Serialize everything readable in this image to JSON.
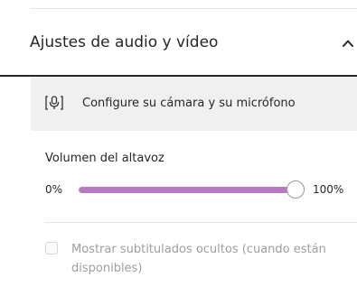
{
  "section": {
    "title": "Ajustes de audio y vídeo",
    "chevron_icon": "chevron-up-icon",
    "expanded": true
  },
  "camera_setup": {
    "icon": "camera-microphone-icon",
    "label": "Configure su cámara y su micrófono"
  },
  "volume": {
    "label": "Volumen del altavoz",
    "min_label": "0%",
    "max_label": "100%",
    "value_percent": 100,
    "fill_color": "#b87bc3"
  },
  "captions": {
    "label": "Mostrar subtitulados ocultos (cuando están disponibles)",
    "checked": false
  }
}
